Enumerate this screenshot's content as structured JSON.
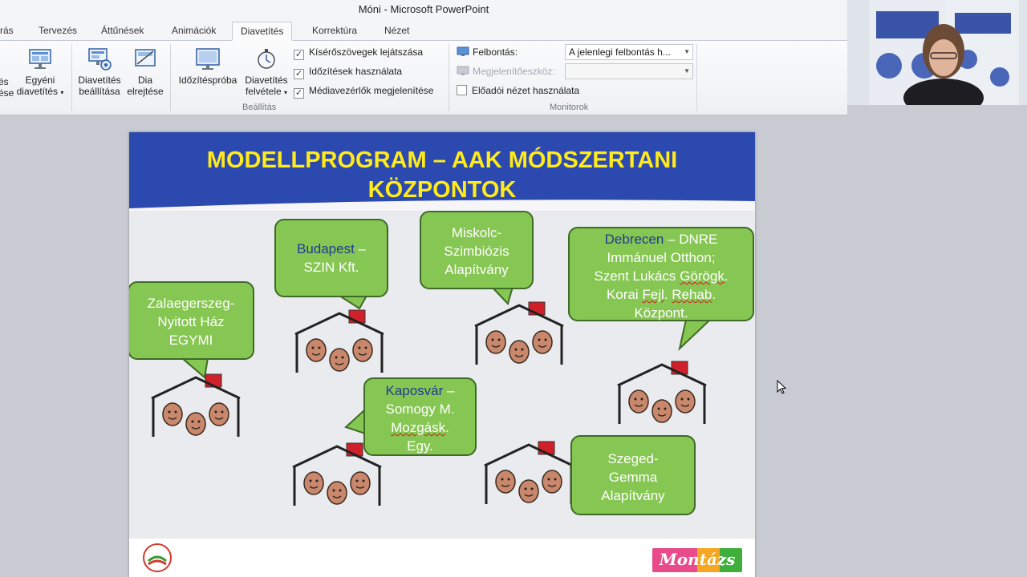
{
  "window": {
    "title": "Móni  -  Microsoft PowerPoint"
  },
  "tabs": [
    {
      "label": "rás",
      "active": false
    },
    {
      "label": "Tervezés",
      "active": false
    },
    {
      "label": "Áttűnések",
      "active": false
    },
    {
      "label": "Animációk",
      "active": false
    },
    {
      "label": "Diavetítés",
      "active": true
    },
    {
      "label": "Korrektúra",
      "active": false
    },
    {
      "label": "Nézet",
      "active": false
    }
  ],
  "ribbon": {
    "start": {
      "line1": "és",
      "line2": "ése"
    },
    "custom_show": {
      "line1": "Egyéni",
      "line2": "diavetítés"
    },
    "setup_show": {
      "line1": "Diavetítés",
      "line2": "beállítása"
    },
    "hide_slide": {
      "line1": "Dia",
      "line2": "elrejtése"
    },
    "rehearse": {
      "line1": "Időzítéspróba"
    },
    "record": {
      "line1": "Diavetítés",
      "line2": "felvétele"
    },
    "checkboxes": [
      {
        "label": "Kísérőszövegek lejátszása",
        "checked": true
      },
      {
        "label": "Időzítések használata",
        "checked": true
      },
      {
        "label": "Médiavezérlők megjelenítése",
        "checked": true
      }
    ],
    "group_setup_label": "Beállítás",
    "resolution_label": "Felbontás:",
    "resolution_value": "A jelenlegi felbontás h...",
    "display_on_label": "Megjelenítőeszköz:",
    "presenter_view_label": "Előadói nézet használata",
    "group_monitors_label": "Monitorok"
  },
  "slide": {
    "title_line1": "MODELLPROGRAM – AAK MÓDSZERTANI",
    "title_line2": "KÖZPONTOK",
    "bubbles": {
      "zalaegerszeg": {
        "line1": "Zalaegerszeg-",
        "line2": "Nyitott Ház",
        "line3": "EGYMI"
      },
      "budapest": {
        "city": "Budapest",
        "rest1": " –",
        "line2": "SZIN Kft."
      },
      "miskolc": {
        "line1": "Miskolc-",
        "line2": "Szimbiózis",
        "line3": "Alapítvány"
      },
      "debrecen": {
        "city": "Debrecen",
        "rest1": " – DNRE",
        "line2": "Immánuel  Otthon;",
        "line3a": "Szent Lukács ",
        "line3b": "Görögk",
        "line3c": ".",
        "line4a": "Korai ",
        "line4b": "Fejl",
        "line4c": ". ",
        "line4d": "Rehab",
        "line4e": ".",
        "line5": "Központ."
      },
      "kaposvar": {
        "city": "Kaposvár",
        "rest1": " –",
        "line2": "Somogy M.",
        "line3a": "Mozgásk",
        "line3b": ".",
        "line4": "Egy."
      },
      "szeged": {
        "line1": "Szeged-",
        "line2": "Gemma",
        "line3": "Alapítvány"
      }
    },
    "footer_logo_text": "Montázs"
  },
  "colors": {
    "slide_header_bg": "#2c49b0",
    "title_text": "#ffeb1a",
    "bubble_fill": "#86c652",
    "house_roof": "#d0202a",
    "face_fill": "#c9876b"
  }
}
